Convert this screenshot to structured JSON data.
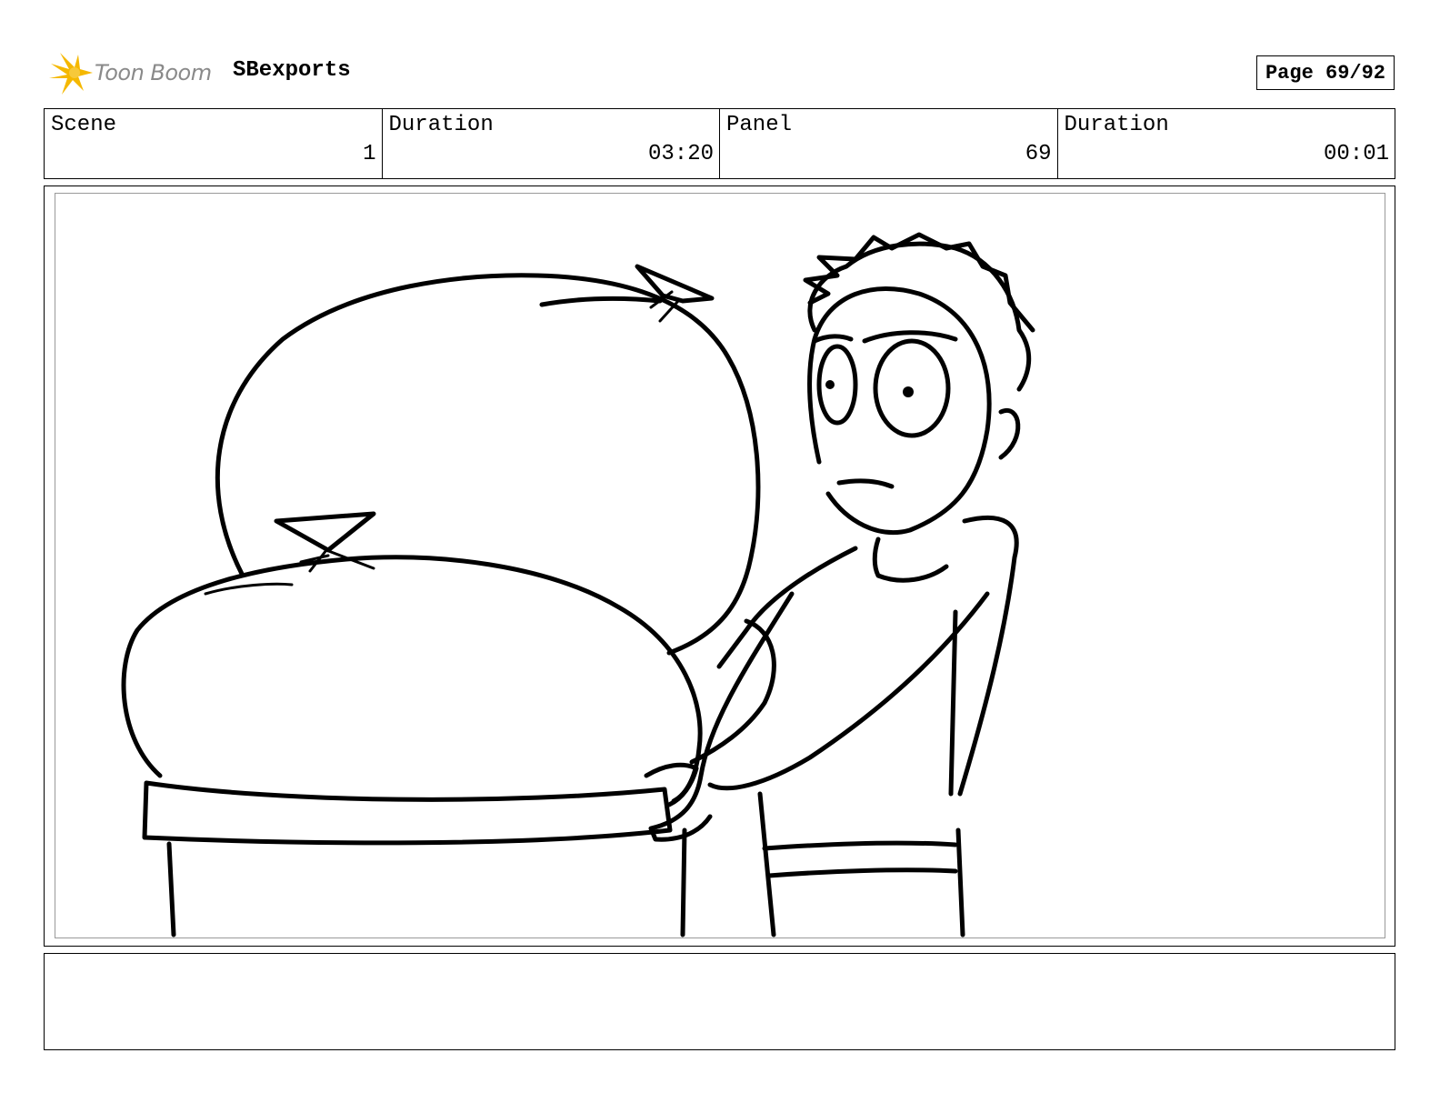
{
  "header": {
    "logo_text": "Toon Boom",
    "project_name": "SBexports",
    "page_label": "Page 69/92"
  },
  "info": {
    "scene_label": "Scene",
    "scene_value": "1",
    "scene_duration_label": "Duration",
    "scene_duration_value": "03:20",
    "panel_label": "Panel",
    "panel_value": "69",
    "panel_duration_label": "Duration",
    "panel_duration_value": "00:01"
  },
  "colors": {
    "logo_accent": "#f5b800",
    "logo_text": "#8a8a8a",
    "border": "#000000",
    "frame_inner_border": "#9a9a9a"
  }
}
